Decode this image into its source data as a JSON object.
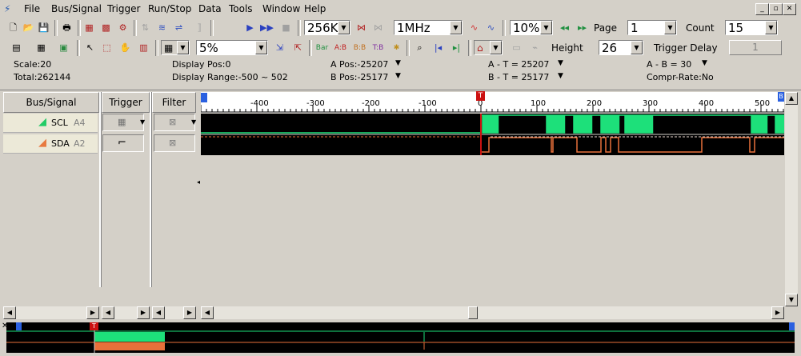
{
  "menu": [
    "File",
    "Bus/Signal",
    "Trigger",
    "Run/Stop",
    "Data",
    "Tools",
    "Window",
    "Help"
  ],
  "window_buttons": [
    "_",
    "▫",
    "✕"
  ],
  "toolbar1": {
    "sample_depth": "256K",
    "sample_rate": "1MHz",
    "trigger_percent": "10%",
    "page_label": "Page",
    "page_value": "1",
    "count_label": "Count",
    "count_value": "15"
  },
  "toolbar2": {
    "zoom_value": "5%",
    "height_label": "Height",
    "height_value": "26",
    "trigger_delay_label": "Trigger Delay",
    "trigger_delay_value": "1"
  },
  "info": {
    "scale": "Scale:20",
    "total": "Total:262144",
    "display_pos": "Display Pos:0",
    "display_range": "Display Range:-500 ~ 502",
    "a_pos": "A Pos:-25207",
    "b_pos": "B Pos:-25177",
    "a_minus_t": "A - T = 25207",
    "b_minus_t": "B - T = 25177",
    "a_minus_b": "A - B = 30",
    "compr_rate": "Compr-Rate:No"
  },
  "headers": {
    "bus_signal": "Bus/Signal",
    "trigger": "Trigger",
    "filter": "Filter"
  },
  "signals": [
    {
      "name": "SCL",
      "channel": "A4",
      "color": "#22cc66"
    },
    {
      "name": "SDA",
      "channel": "A2",
      "color": "#e87a40"
    }
  ],
  "ruler_labels": [
    "-400",
    "-300",
    "-200",
    "-100",
    "0",
    "100",
    "200",
    "300",
    "400",
    "500"
  ],
  "markers": {
    "trigger": "T",
    "b_marker": "B"
  },
  "colors": {
    "scl": "#1de07a",
    "sda": "#e8703a",
    "trigger": "#cc1111",
    "background": "#000000"
  }
}
